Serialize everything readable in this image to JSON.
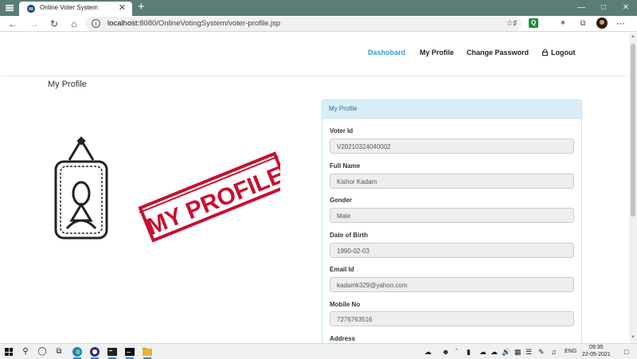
{
  "browser": {
    "tab_title": "Online Voter System",
    "tab_close": "✕",
    "new_tab": "+",
    "url_host": "localhost",
    "url_rest": ":8080/OnlineVotingSystem/voter-profile.jsp",
    "extension_label": "Q"
  },
  "navbar": {
    "links": [
      "Dashobard",
      "My Profile",
      "Change Password",
      "Logout"
    ],
    "active_link": "Dashobard"
  },
  "page": {
    "heading": "My Profile",
    "stamp_text": "MY PROFILE"
  },
  "panel": {
    "title": "My Profile",
    "fields": [
      {
        "label": "Voter Id",
        "value": "V20210324040002"
      },
      {
        "label": "Full Name",
        "value": "Kishor Kadam"
      },
      {
        "label": "Gender",
        "value": "Male"
      },
      {
        "label": "Date of Birth",
        "value": "1990-02-03"
      },
      {
        "label": "Email Id",
        "value": "kadamk329@yahoo.com"
      },
      {
        "label": "Mobile No",
        "value": "7276763516"
      },
      {
        "label": "Address",
        "value": ""
      }
    ]
  },
  "taskbar": {
    "language": "ENG",
    "time": "09:35",
    "date": "22-05-2021"
  },
  "colors": {
    "tabstrip": "#5a7d78",
    "accent_link": "#2a9fd6",
    "panel_header": "#d9edf7",
    "stamp_red": "#c8102e"
  }
}
